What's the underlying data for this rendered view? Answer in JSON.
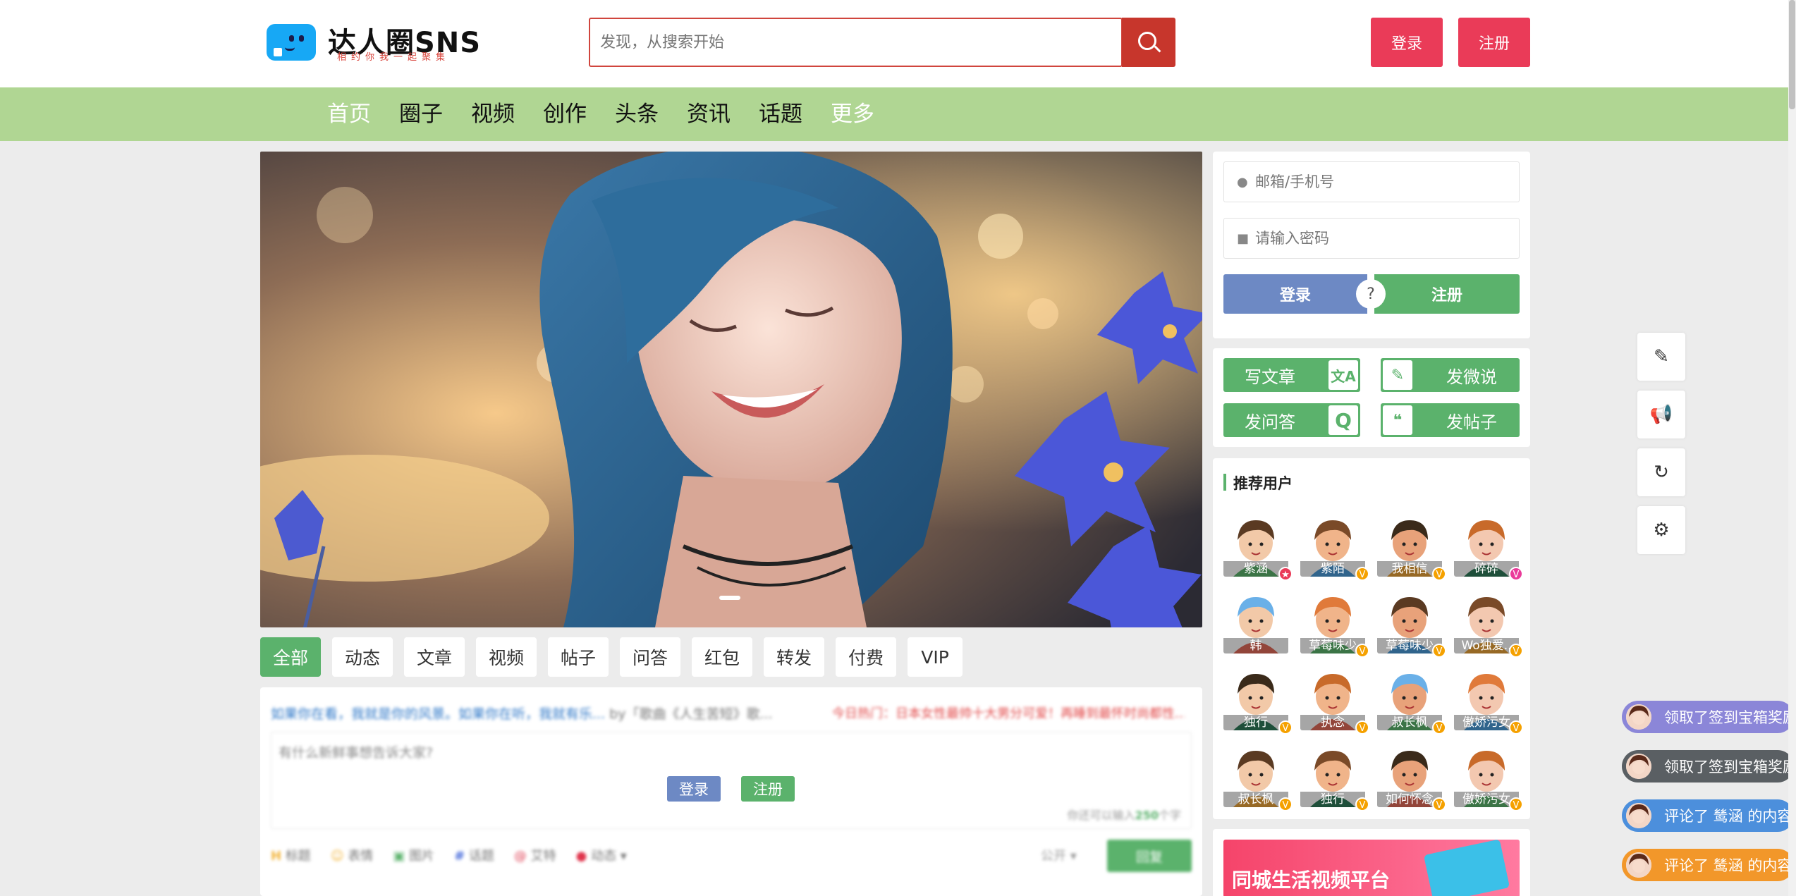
{
  "header": {
    "logo_text": "达人圈SNS",
    "logo_sub": "相约你我一起聚集",
    "search_placeholder": "发现，从搜索开始",
    "login_label": "登录",
    "register_label": "注册"
  },
  "nav": [
    "首页",
    "圈子",
    "视频",
    "创作",
    "头条",
    "资讯",
    "话题",
    "更多"
  ],
  "tabs": [
    "全部",
    "动态",
    "文章",
    "视频",
    "帖子",
    "问答",
    "红包",
    "转发",
    "付费",
    "VIP"
  ],
  "post": {
    "marquee_left": "如果你在看，我就是你的风景。如果你在听，我就有乐...",
    "marquee_by": " by「歌曲《人生苦短》歌...",
    "marquee_right": "今日热门：日本女性最帅十大男分可爱！再睡到最怀时尚都性...",
    "placeholder": "有什么新鲜事想告诉大家?",
    "login_label": "登录",
    "register_label": "注册",
    "char_hint_prefix": "你还可以输入",
    "char_hint_count": "250",
    "char_hint_suffix": "个字",
    "tools": [
      "标题",
      "表情",
      "图片",
      "话题",
      "艾特",
      "动态"
    ],
    "visibility": "公开",
    "submit_label": "回复"
  },
  "login": {
    "account_placeholder": "邮箱/手机号",
    "password_placeholder": "请输入密码",
    "login_label": "登录",
    "help_label": "?",
    "register_label": "注册"
  },
  "actions": [
    {
      "label": "写文章",
      "icon": "translate-icon"
    },
    {
      "label": "发微说",
      "icon": "edit-icon"
    },
    {
      "label": "发问答",
      "icon": "q-icon"
    },
    {
      "label": "发帖子",
      "icon": "chat-icon"
    }
  ],
  "recommend": {
    "title": "推荐用户",
    "users": [
      "紫涵",
      "紫陌",
      "我相信",
      "碎碎",
      "韩",
      "草莓味少",
      "草莓味少",
      "Wo独爱..",
      "独行",
      "执念",
      "叔长枫",
      "傲娇污女",
      "叔长枫",
      "独行",
      "如何怀念",
      "傲娇污女"
    ]
  },
  "ad": {
    "text": "同城生活视频平台"
  },
  "float_icons": [
    "edit-icon",
    "megaphone-icon",
    "refresh-icon",
    "gear-icon"
  ],
  "activity": [
    {
      "text": "领取了签到宝箱奖励",
      "color": "#8b86d8"
    },
    {
      "text": "领取了签到宝箱奖励",
      "color": "#5a5f63"
    },
    {
      "text": "评论了 鸶涵 的内容",
      "color": "#4c8fdc"
    },
    {
      "text": "评论了 鸶涵 的内容",
      "color": "#f2972a"
    }
  ],
  "colors": {
    "green": "#5bb26c",
    "nav": "#b0d693",
    "red": "#ea3b58",
    "blue_btn": "#6d89c4"
  }
}
